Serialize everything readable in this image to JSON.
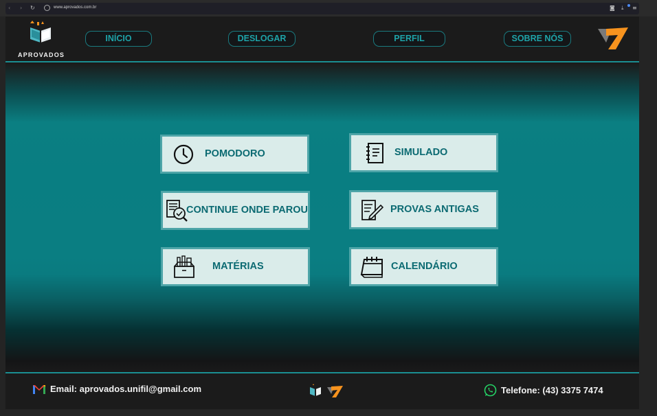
{
  "browser": {
    "url": "www.aprovados.com.br",
    "icons": [
      "back-icon",
      "forward-icon",
      "reload-icon",
      "site-info-icon",
      "camera-icon",
      "download-icon",
      "menu-icon"
    ]
  },
  "header": {
    "logo_text": "APROVADOS",
    "nav": {
      "inicio": "INÍCIO",
      "deslogar": "DESLOGAR",
      "perfil": "PERFIL",
      "sobre": "SOBRE NÓS"
    }
  },
  "tiles": {
    "pomodoro": "POMODORO",
    "simulado": "SIMULADO",
    "continue": "CONTINUE ONDE PAROU",
    "provas": "PROVAS ANTIGAS",
    "materias": "MATÉRIAS",
    "calendario": "CALENDÁRIO"
  },
  "footer": {
    "email": "Email: aprovados.unifil@gmail.com",
    "phone": "Telefone: (43) 3375 7474"
  },
  "colors": {
    "accent": "#1a8f93",
    "tile_bg": "#daecea",
    "tile_text": "#0b6a72",
    "brand_orange": "#f7931e"
  }
}
